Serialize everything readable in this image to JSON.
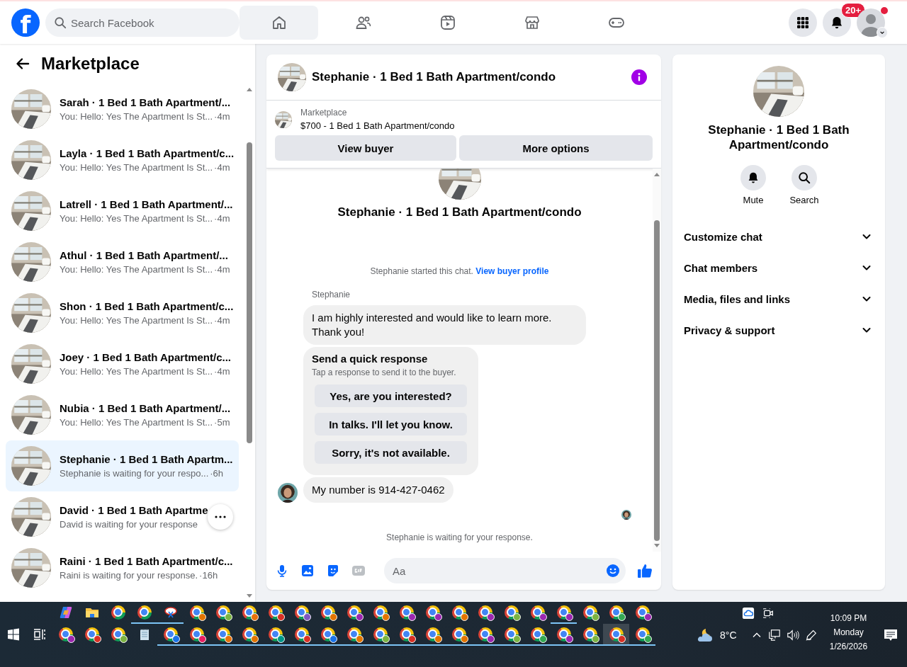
{
  "top_bar": {
    "logo": "f",
    "search": {
      "placeholder": "Search Facebook"
    },
    "nav_tabs": [
      {
        "kind": "home",
        "selected": true
      },
      {
        "kind": "friends",
        "selected": false
      },
      {
        "kind": "video",
        "selected": false
      },
      {
        "kind": "store",
        "selected": false
      },
      {
        "kind": "gaming",
        "selected": false
      }
    ],
    "notifications_badge": "20+"
  },
  "sidebar": {
    "title": "Marketplace",
    "conversations": [
      {
        "name": "Sarah · 1 Bed 1 Bath Apartment/...",
        "preview": "You: Hello: Yes The Apartment Is St...",
        "time": "·4m",
        "selected": false
      },
      {
        "name": "Layla · 1 Bed 1 Bath Apartment/c...",
        "preview": "You: Hello: Yes The Apartment Is St...",
        "time": "·4m",
        "selected": false
      },
      {
        "name": "Latrell · 1 Bed 1 Bath Apartment/...",
        "preview": "You: Hello: Yes The Apartment Is St...",
        "time": "·4m",
        "selected": false
      },
      {
        "name": "Athul · 1 Bed 1 Bath Apartment/...",
        "preview": "You: Hello: Yes The Apartment Is St...",
        "time": "·4m",
        "selected": false
      },
      {
        "name": "Shon · 1 Bed 1 Bath Apartment/c...",
        "preview": "You: Hello: Yes The Apartment Is St...",
        "time": "·4m",
        "selected": false
      },
      {
        "name": "Joey · 1 Bed 1 Bath Apartment/c...",
        "preview": "You: Hello: Yes The Apartment Is St...",
        "time": "·4m",
        "selected": false
      },
      {
        "name": "Nubia · 1 Bed 1 Bath Apartment/...",
        "preview": "You: Hello: Yes The Apartment Is St...",
        "time": "·5m",
        "selected": false
      },
      {
        "name": "Stephanie · 1 Bed 1 Bath Apartm...",
        "preview": "Stephanie is waiting for your respo...",
        "time": "·6h",
        "selected": true
      },
      {
        "name": "David · 1 Bed 1 Bath Apartme",
        "preview": "David is waiting for your response",
        "more_button": true,
        "selected": false
      },
      {
        "name": "Raini · 1 Bed 1 Bath Apartment/c...",
        "preview": "Raini is waiting for your response.",
        "time": "·16h",
        "selected": false
      }
    ]
  },
  "chat": {
    "title": "Stephanie · 1 Bed 1 Bath Apartment/condo",
    "listing": {
      "source": "Marketplace",
      "title": "$700 - 1 Bed 1 Bath Apartment/condo"
    },
    "actions": [
      "View buyer",
      "More options"
    ],
    "intro_title": "Stephanie · 1 Bed 1 Bath Apartment/condo",
    "intro_note": "Stephanie started this chat.",
    "intro_link": "View buyer profile",
    "messages": [
      {
        "kind": "text",
        "sender": "Stephanie",
        "text": " I am highly interested and would like to learn more. Thank you!",
        "avatar": false
      },
      {
        "kind": "quick_response",
        "title": "Send a quick response",
        "subtitle": "Tap a response to send it to the buyer.",
        "options": [
          "Yes, are you interested?",
          "In talks. I'll let you know.",
          "Sorry, it's not available."
        ]
      },
      {
        "kind": "text",
        "text": "My number is 914-427-0462",
        "avatar": true
      }
    ],
    "status": "Stephanie is waiting for your response.",
    "composer": {
      "placeholder": "Aa"
    }
  },
  "details": {
    "name": "Stephanie · 1 Bed 1 Bath Apartment/condo",
    "actions": [
      {
        "kind": "mute",
        "label": "Mute"
      },
      {
        "kind": "search",
        "label": "Search"
      }
    ],
    "sections": [
      {
        "label": "Customize chat",
        "expanded": false
      },
      {
        "label": "Chat members",
        "expanded": false
      },
      {
        "label": "Media, files and links",
        "expanded": false
      },
      {
        "label": "Privacy & support",
        "expanded": false
      }
    ]
  },
  "taskbar": {
    "rows": [
      {
        "items": [
          {
            "kind": "copilot",
            "open": false,
            "selected": false
          },
          {
            "kind": "folder",
            "open": false,
            "selected": false
          },
          {
            "kind": "browser",
            "open": false,
            "selected": false
          },
          {
            "kind": "browser",
            "open": true,
            "selected": false
          },
          {
            "kind": "snip",
            "open": true,
            "selected": false
          },
          {
            "kind": "browser",
            "color": "#e37400",
            "open": false,
            "selected": false
          },
          {
            "kind": "browser",
            "color": "#7cb342",
            "open": false,
            "selected": false
          },
          {
            "kind": "browser",
            "color": "#e8710a",
            "open": false,
            "selected": false
          },
          {
            "kind": "browser",
            "color": "#d93025",
            "open": false,
            "selected": false
          },
          {
            "kind": "browser",
            "color": "#7e57c2",
            "open": false,
            "selected": false
          },
          {
            "kind": "browser",
            "color": "#e37400",
            "open": false,
            "selected": false
          },
          {
            "kind": "browser",
            "color": "#9c27b0",
            "open": false,
            "selected": false
          },
          {
            "kind": "browser",
            "color": "#e37400",
            "open": false,
            "selected": false
          },
          {
            "kind": "browser",
            "color": "#9c27b0",
            "open": false,
            "selected": false
          },
          {
            "kind": "browser",
            "color": "#9c27b0",
            "open": false,
            "selected": false
          },
          {
            "kind": "browser",
            "color": "#e37400",
            "open": false,
            "selected": false
          },
          {
            "kind": "browser",
            "color": "#9c27b0",
            "open": false,
            "selected": false
          },
          {
            "kind": "browser",
            "color": "#7cb342",
            "open": false,
            "selected": false
          },
          {
            "kind": "browser",
            "color": "#9c27b0",
            "open": false,
            "selected": false
          },
          {
            "kind": "browser",
            "color": "#9c27b0",
            "open": true,
            "selected": false
          },
          {
            "kind": "browser",
            "color": "#7cb342",
            "open": false,
            "selected": false
          },
          {
            "kind": "browser",
            "color": "#34a853",
            "open": false,
            "selected": false
          },
          {
            "kind": "browser",
            "color": "#9c27b0",
            "open": false,
            "selected": false
          }
        ]
      },
      {
        "items": [
          {
            "kind": "start",
            "open": false,
            "selected": false
          },
          {
            "kind": "task_view",
            "open": false,
            "selected": false
          },
          {
            "kind": "browser",
            "color": "#9c27b0",
            "open": false,
            "selected": false
          },
          {
            "kind": "browser",
            "color": "#d93025",
            "open": false,
            "selected": false
          },
          {
            "kind": "browser",
            "color": "#7cb342",
            "open": false,
            "selected": false
          },
          {
            "kind": "notepad",
            "open": false,
            "selected": false
          },
          {
            "kind": "browser",
            "color": "#1a73e8",
            "open": true,
            "selected": false
          },
          {
            "kind": "browser",
            "color": "#e91e63",
            "open": true,
            "selected": false
          },
          {
            "kind": "browser",
            "color": "#e8710a",
            "open": true,
            "selected": false
          },
          {
            "kind": "browser",
            "color": "#e37400",
            "open": true,
            "selected": false
          },
          {
            "kind": "browser",
            "color": "#009688",
            "open": true,
            "selected": false
          },
          {
            "kind": "browser",
            "color": "#d93025",
            "open": true,
            "selected": false
          },
          {
            "kind": "browser",
            "color": "#1a73e8",
            "open": true,
            "selected": false
          },
          {
            "kind": "browser",
            "color": "#e37400",
            "open": true,
            "selected": false
          },
          {
            "kind": "browser",
            "color": "#7cb342",
            "open": true,
            "selected": false
          },
          {
            "kind": "browser",
            "color": "#d93025",
            "open": true,
            "selected": false
          },
          {
            "kind": "browser",
            "color": "#e37400",
            "open": true,
            "selected": false
          },
          {
            "kind": "browser",
            "color": "#e37400",
            "open": true,
            "selected": false
          },
          {
            "kind": "browser",
            "color": "#9c27b0",
            "open": true,
            "selected": false
          },
          {
            "kind": "browser",
            "color": "#7cb342",
            "open": true,
            "selected": false
          },
          {
            "kind": "browser",
            "color": "#34a853",
            "open": true,
            "selected": false
          },
          {
            "kind": "browser",
            "color": "#9c27b0",
            "open": true,
            "selected": false
          },
          {
            "kind": "browser",
            "color": "#7cb342",
            "open": true,
            "selected": false
          },
          {
            "kind": "browser",
            "color": "#d93025",
            "open": true,
            "selected": true
          },
          {
            "kind": "browser",
            "color": "#34a853",
            "open": true,
            "selected": false
          }
        ]
      }
    ],
    "temperature": "8°C",
    "time": "10:09 PM",
    "day": "Monday",
    "date": "1/26/2026"
  }
}
